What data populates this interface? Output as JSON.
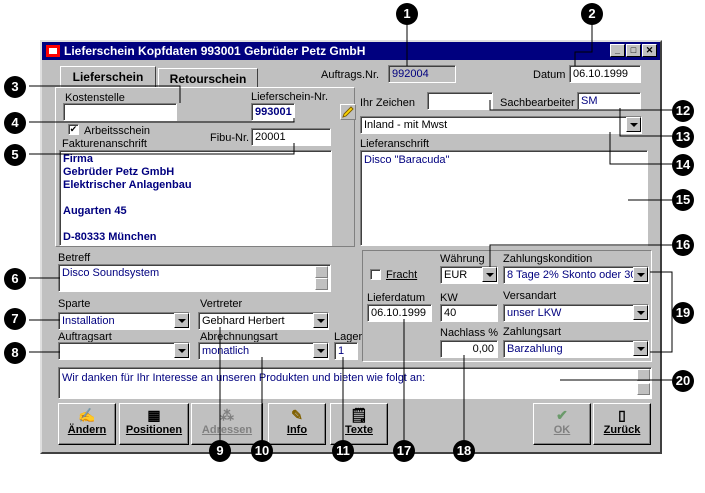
{
  "window": {
    "title": "Lieferschein Kopfdaten 993001 Gebrüder Petz GmbH"
  },
  "tabs": [
    {
      "label": "Lieferschein"
    },
    {
      "label": "Retourschein"
    }
  ],
  "auftrags": {
    "label": "Auftrags.Nr.",
    "value": "992004"
  },
  "datum": {
    "label": "Datum",
    "value": "06.10.1999"
  },
  "kostenstelle": {
    "label": "Kostenstelle",
    "value": ""
  },
  "lieferschein_nr": {
    "label": "Lieferschein-Nr.",
    "value": "993001"
  },
  "arbeitsschein": {
    "label": "Arbeitsschein",
    "checked": "✔"
  },
  "fibu": {
    "label": "Fibu-Nr.",
    "value": "20001"
  },
  "fakturen": {
    "label": "Fakturenanschrift",
    "lines": [
      "Firma",
      "Gebrüder Petz GmbH",
      "Elektrischer Anlagenbau",
      "",
      "Augarten 45",
      "",
      "D-80333 München"
    ]
  },
  "ihr_zeichen": {
    "label": "Ihr Zeichen",
    "value": ""
  },
  "sachbearbeiter": {
    "label": "Sachbearbeiter",
    "value": "SM"
  },
  "steuer": {
    "value": "Inland - mit Mwst"
  },
  "lieferanschrift": {
    "label": "Lieferanschrift",
    "value": "Disco \"Baracuda\""
  },
  "betreff": {
    "label": "Betreff",
    "value": "Disco Soundsystem"
  },
  "sparte": {
    "label": "Sparte",
    "value": "Installation"
  },
  "vertreter": {
    "label": "Vertreter",
    "value": "Gebhard Herbert"
  },
  "auftragsart": {
    "label": "Auftragsart",
    "value": ""
  },
  "abrechnungsart": {
    "label": "Abrechnungsart",
    "value": "monatlich"
  },
  "lager": {
    "label": "Lager",
    "value": "1"
  },
  "fracht": {
    "label": "Fracht"
  },
  "waehrung": {
    "label": "Währung",
    "value": "EUR"
  },
  "zahlungskondition": {
    "label": "Zahlungskondition",
    "value": "8 Tage 2% Skonto oder 30"
  },
  "lieferdatum": {
    "label": "Lieferdatum",
    "value": "06.10.1999"
  },
  "kw": {
    "label": "KW",
    "value": "40"
  },
  "versandart": {
    "label": "Versandart",
    "value": "unser LKW"
  },
  "nachlass": {
    "label": "Nachlass %",
    "value": "0,00"
  },
  "zahlungsart": {
    "label": "Zahlungsart",
    "value": "Barzahlung"
  },
  "text": {
    "value": "Wir danken für Ihr Interesse an unseren Produkten und bieten wie folgt an:"
  },
  "toolbar": {
    "aendern": "Ändern",
    "positionen": "Positionen",
    "adressen": "Adressen",
    "info": "Info",
    "texte": "Texte",
    "ok": "OK",
    "zurueck": "Zurück"
  },
  "callouts": [
    "1",
    "2",
    "3",
    "4",
    "5",
    "6",
    "7",
    "8",
    "9",
    "10",
    "11",
    "12",
    "13",
    "14",
    "15",
    "16",
    "17",
    "18",
    "19",
    "20"
  ]
}
